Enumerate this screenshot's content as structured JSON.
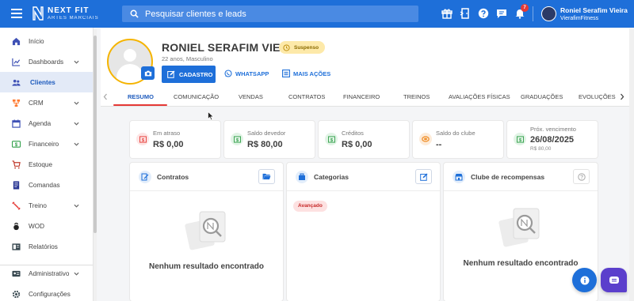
{
  "header": {
    "brand_main": "NEXT FIT",
    "brand_sub": "ARTES MARCIAIS",
    "search_placeholder": "Pesquisar clientes e leads",
    "notification_count": "7",
    "user_name": "Roniel Serafim Vieira",
    "user_org": "VierafimFitness",
    "icons": [
      "gift-icon",
      "door-exit-icon",
      "help-icon",
      "chat-icon",
      "bell-icon"
    ]
  },
  "sidebar": {
    "items": [
      {
        "label": "Início",
        "icon": "home-icon",
        "chevron": false,
        "active": false
      },
      {
        "label": "Dashboards",
        "icon": "chart-line-icon",
        "chevron": true,
        "active": false
      },
      {
        "label": "Clientes",
        "icon": "users-icon",
        "chevron": false,
        "active": true
      },
      {
        "label": "CRM",
        "icon": "crm-icon",
        "chevron": true,
        "active": false
      },
      {
        "label": "Agenda",
        "icon": "calendar-icon",
        "chevron": true,
        "active": false
      },
      {
        "label": "Financeiro",
        "icon": "money-icon",
        "chevron": true,
        "active": false
      },
      {
        "label": "Estoque",
        "icon": "cart-icon",
        "chevron": false,
        "active": false
      },
      {
        "label": "Comandas",
        "icon": "receipt-icon",
        "chevron": false,
        "active": false
      },
      {
        "label": "Treino",
        "icon": "dumbbell-icon",
        "chevron": true,
        "active": false
      },
      {
        "label": "WOD",
        "icon": "kettlebell-icon",
        "chevron": false,
        "active": false
      },
      {
        "label": "Relatórios",
        "icon": "report-icon",
        "chevron": false,
        "active": false
      },
      {
        "label": "Administrativo",
        "icon": "id-card-icon",
        "chevron": true,
        "active": false
      },
      {
        "label": "Configurações",
        "icon": "settings-icon",
        "chevron": false,
        "active": false
      }
    ]
  },
  "profile": {
    "name": "RONIEL SERAFIM VIEIRA",
    "status": "Suspenso",
    "subtitle": "22 anos, Masculino",
    "buttons": {
      "cadastro": "CADASTRO",
      "whatsapp": "WHATSAPP",
      "mais_acoes": "MAIS AÇÕES"
    }
  },
  "tabs": [
    "RESUMO",
    "COMUNICAÇÃO",
    "VENDAS",
    "CONTRATOS",
    "FINANCEIRO",
    "TREINOS",
    "AVALIAÇÕES FÍSICAS",
    "GRADUAÇÕES",
    "EVOLUÇÕES"
  ],
  "stats": [
    {
      "label": "Em atraso",
      "value": "R$ 0,00",
      "extra": ""
    },
    {
      "label": "Saldo devedor",
      "value": "R$ 80,00",
      "extra": ""
    },
    {
      "label": "Créditos",
      "value": "R$ 0,00",
      "extra": ""
    },
    {
      "label": "Saldo do clube",
      "value": "--",
      "extra": ""
    },
    {
      "label": "Próx. vencimento",
      "value": "26/08/2025",
      "extra": "R$ 80,00"
    }
  ],
  "panels": {
    "contratos": {
      "title": "Contratos",
      "empty": "Nenhum resultado encontrado"
    },
    "categorias": {
      "title": "Categorias",
      "chip": "Avançado"
    },
    "clube": {
      "title": "Clube de recompensas",
      "empty": "Nenhum resultado encontrado"
    }
  },
  "colors": {
    "primary": "#1e6fd9",
    "danger": "#e53935",
    "status_bg": "#fde9a9",
    "chat": "#5b3fcc"
  }
}
